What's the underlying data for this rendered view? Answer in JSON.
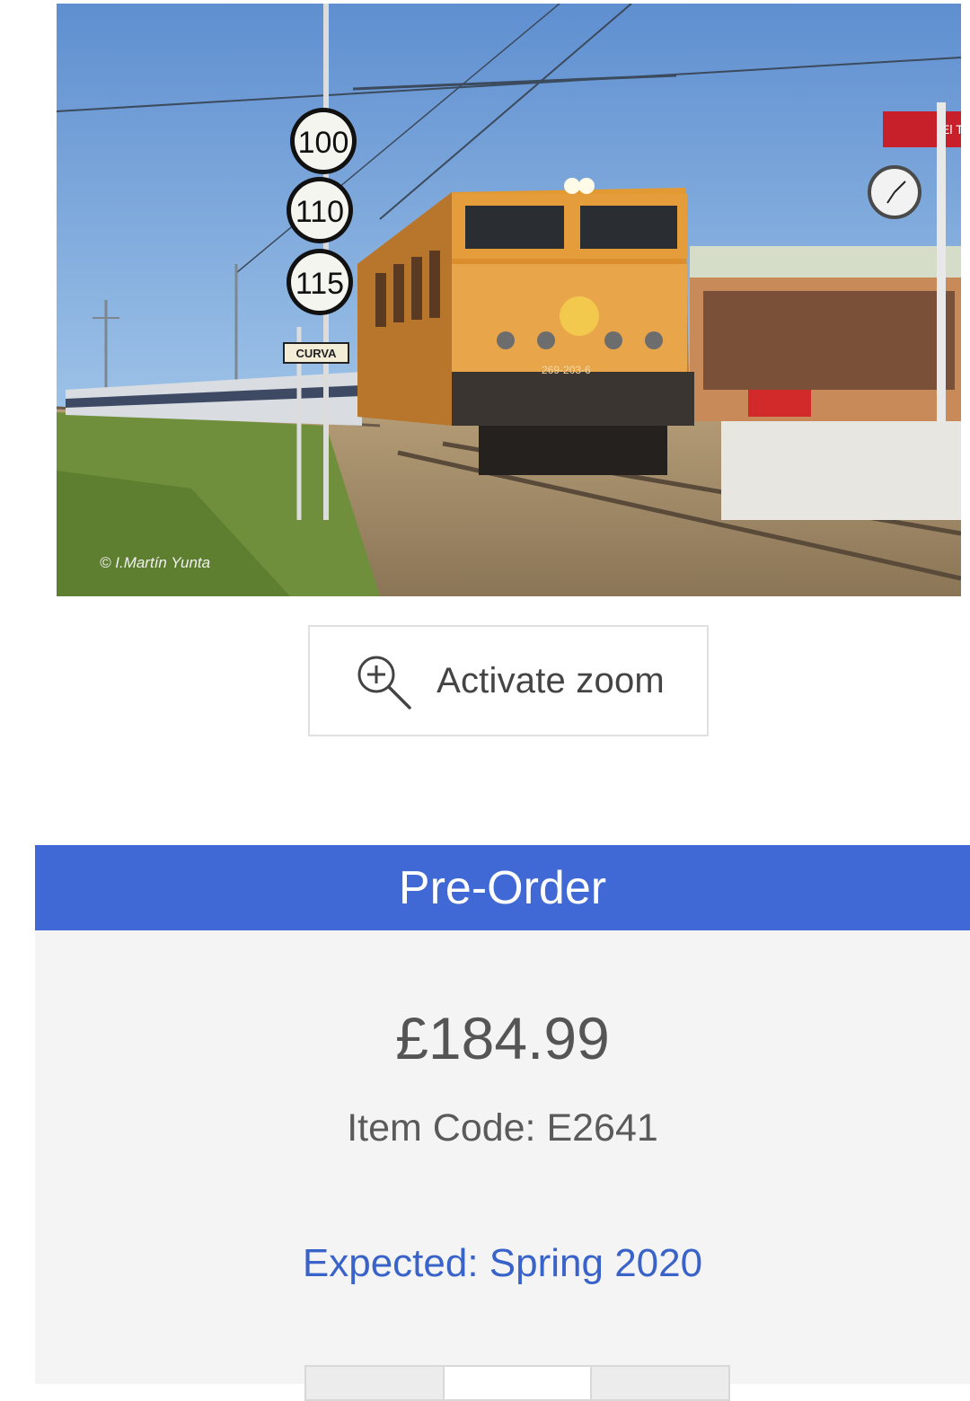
{
  "product_image": {
    "alt": "Orange electric locomotive 269-203-6 hauling passenger coaches past a station platform",
    "photo_credit": "© I.Martín Yunta",
    "loco_number": "269-203-6",
    "speed_signs": [
      "100",
      "110",
      "115"
    ],
    "curve_sign": "CURVA",
    "station_sign": "El Te"
  },
  "zoom_button": {
    "label": "Activate zoom",
    "icon": "zoom-in-icon"
  },
  "status": {
    "label": "Pre-Order",
    "color": "#4169d5"
  },
  "product": {
    "price": "£184.99",
    "item_code": "Item Code: E2641",
    "expected": "Expected: Spring 2020",
    "expected_color": "#3a63c9"
  },
  "quantity": {
    "value": ""
  }
}
